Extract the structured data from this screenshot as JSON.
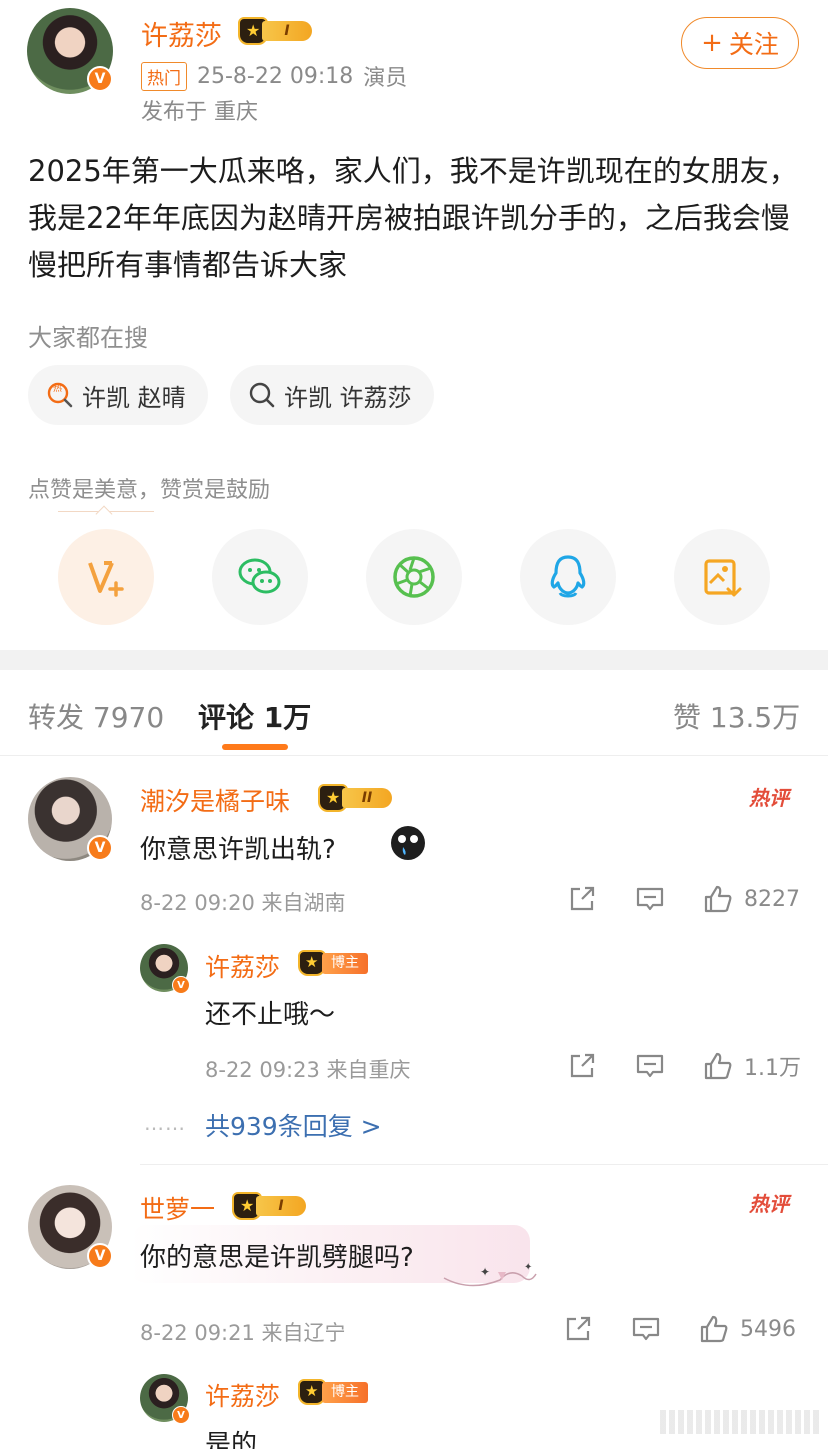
{
  "post": {
    "author": {
      "name": "许荔莎",
      "level": "I",
      "hot_tag": "热门",
      "timestamp": "25-8-22 09:18",
      "role": "演员",
      "location": "发布于 重庆",
      "follow_label": "关注"
    },
    "content": "2025年第一大瓜来咯，家人们，我不是许凯现在的女朋友，我是22年年底因为赵晴开房被拍跟许凯分手的，之后我会慢慢把所有事情都告诉大家",
    "search": {
      "title": "大家都在搜",
      "chips": [
        {
          "icon": "hot-search-icon",
          "label": "许凯 赵晴"
        },
        {
          "icon": "search-icon",
          "label": "许凯 许荔莎"
        }
      ]
    },
    "reward_text": "点赞是美意，赞赏是鼓励",
    "share_buttons": [
      {
        "name": "reward-button",
        "icon": "v-plus-icon",
        "color": "#f4a13e"
      },
      {
        "name": "wechat-share-button",
        "icon": "wechat-icon",
        "color": "#2cbd62"
      },
      {
        "name": "moments-share-button",
        "icon": "moments-icon",
        "color": "#57c04f"
      },
      {
        "name": "qq-share-button",
        "icon": "qq-icon",
        "color": "#1fa6e6"
      },
      {
        "name": "save-image-button",
        "icon": "save-image-icon",
        "color": "#f5a623"
      }
    ]
  },
  "tabs": {
    "repost": "转发 7970",
    "comments": "评论 1万",
    "likes": "赞 13.5万"
  },
  "comments": [
    {
      "user": "潮汐是橘子味",
      "level": "II",
      "text": "你意思许凯出轨?",
      "hot_label": "热评",
      "meta": "8-22 09:20 来自湖南",
      "likes": "8227",
      "reply": {
        "user": "许荔莎",
        "badge": "博主",
        "text": "还不止哦～",
        "meta": "8-22 09:23 来自重庆",
        "likes": "1.1万"
      },
      "more_replies": "共939条回复 >"
    },
    {
      "user": "世萝一",
      "level": "I",
      "text": "你的意思是许凯劈腿吗?",
      "hot_label": "热评",
      "meta": "8-22 09:21 来自辽宁",
      "likes": "5496",
      "reply": {
        "user": "许荔莎",
        "badge": "博主",
        "text": "是的"
      }
    }
  ]
}
